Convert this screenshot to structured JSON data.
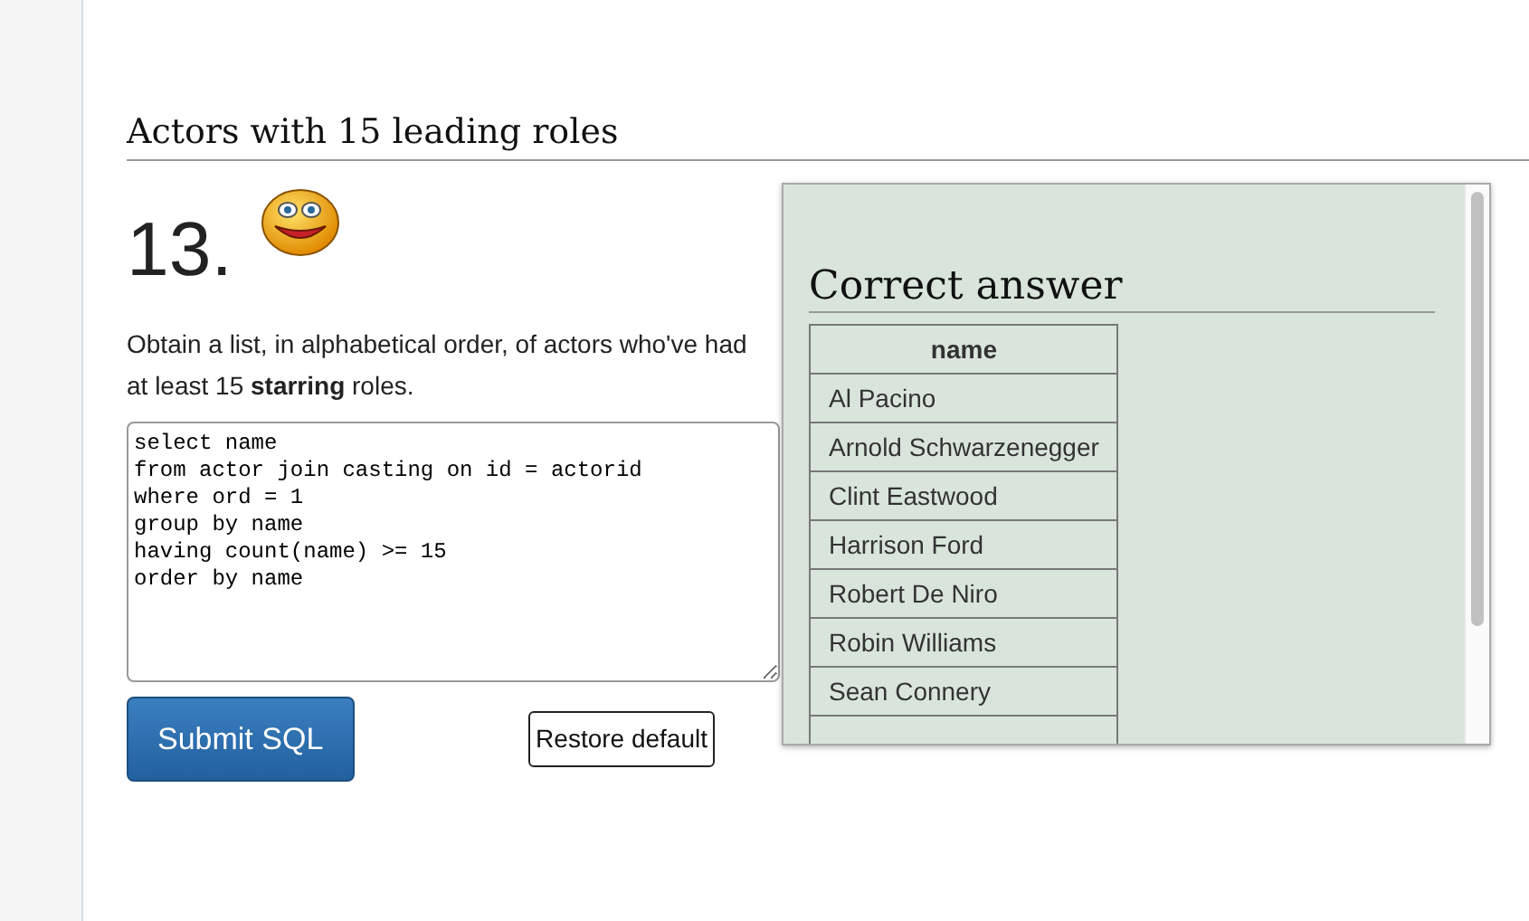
{
  "section_title": "Actors with 15 leading roles",
  "question": {
    "number": "13.",
    "text": "Obtain a list, in alphabetical order, of actors who've had at least 15 **starring** roles."
  },
  "editor": {
    "value": "select name\nfrom actor join casting on id = actorid\nwhere ord = 1\ngroup by name\nhaving count(name) >= 15\norder by name"
  },
  "buttons": {
    "submit": "Submit SQL",
    "restore": "Restore default"
  },
  "answer": {
    "title": "Correct answer",
    "columns": [
      "name"
    ],
    "rows": [
      [
        "Al Pacino"
      ],
      [
        "Arnold Schwarzenegger"
      ],
      [
        "Clint Eastwood"
      ],
      [
        "Harrison Ford"
      ],
      [
        "Robert De Niro"
      ],
      [
        "Robin Williams"
      ],
      [
        "Sean Connery"
      ]
    ]
  }
}
